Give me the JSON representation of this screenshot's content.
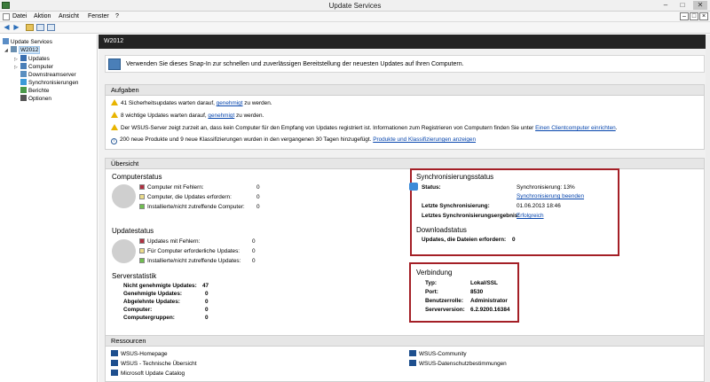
{
  "window": {
    "title": "Update Services"
  },
  "menu": {
    "items": [
      "Datei",
      "Aktion",
      "Ansicht",
      "Fenster",
      "?"
    ]
  },
  "tree": {
    "root": "Update Services",
    "server": "W2012",
    "items": [
      "Updates",
      "Computer",
      "Downstreamserver",
      "Synchronisierungen",
      "Berichte",
      "Optionen"
    ]
  },
  "main": {
    "header": "W2012",
    "intro": "Verwenden Sie dieses Snap-In zur schnellen und zuverlässigen Bereitstellung der neuesten Updates auf Ihren Computern."
  },
  "tasks": {
    "title": "Aufgaben",
    "line1": {
      "pre": "41 Sicherheitsupdates warten darauf, ",
      "link": "genehmigt",
      "post": " zu werden."
    },
    "line2": {
      "pre": "8 wichtige Updates warten darauf, ",
      "link": "genehmigt",
      "post": " zu werden."
    },
    "line3": {
      "pre": "Der WSUS-Server zeigt zurzeit an, dass kein Computer für den Empfang von Updates registriert ist. Informationen zum Registrieren von Computern finden Sie unter ",
      "link": "Einen Clientcomputer einrichten",
      "post": "."
    },
    "line4": {
      "pre": "200 neue Produkte und 9 neue Klassifizierungen wurden in den vergangenen 30 Tagen hinzugefügt. ",
      "link": "Produkte und Klassifizierungen anzeigen"
    }
  },
  "overview": {
    "title": "Übersicht",
    "computer_status": {
      "title": "Computerstatus",
      "rows": [
        {
          "label": "Computer mit Fehlern:",
          "value": "0",
          "color": "#b03040"
        },
        {
          "label": "Computer, die Updates erfordern:",
          "value": "0",
          "color": "#ecdc8a"
        },
        {
          "label": "Installierte/nicht zutreffende Computer:",
          "value": "0",
          "color": "#6fbf4f"
        }
      ]
    },
    "update_status": {
      "title": "Updatestatus",
      "rows": [
        {
          "label": "Updates mit Fehlern:",
          "value": "0",
          "color": "#b03040"
        },
        {
          "label": "Für Computer erforderliche Updates:",
          "value": "0",
          "color": "#ecdc8a"
        },
        {
          "label": "Installierte/nicht zutreffende Updates:",
          "value": "0",
          "color": "#6fbf4f"
        }
      ]
    },
    "server_stats": {
      "title": "Serverstatistik",
      "rows": [
        {
          "label": "Nicht genehmigte Updates:",
          "value": "47"
        },
        {
          "label": "Genehmigte Updates:",
          "value": "0"
        },
        {
          "label": "Abgelehnte Updates:",
          "value": "0"
        },
        {
          "label": "Computer:",
          "value": "0"
        },
        {
          "label": "Computergruppen:",
          "value": "0"
        }
      ]
    },
    "sync": {
      "title": "Synchronisierungsstatus",
      "status_label": "Status:",
      "status_value": "Synchronisierung: 13%",
      "status_link": "Synchronisierung beenden",
      "last_sync_label": "Letzte Synchronisierung:",
      "last_sync_value": "01.06.2013 18:46",
      "last_result_label": "Letztes Synchronisierungsergebnis:",
      "last_result_value": "Erfolgreich"
    },
    "download": {
      "title": "Downloadstatus",
      "label": "Updates, die Dateien erfordern:",
      "value": "0"
    },
    "connection": {
      "title": "Verbindung",
      "rows": [
        {
          "label": "Typ:",
          "value": "Lokal/SSL"
        },
        {
          "label": "Port:",
          "value": "8530"
        },
        {
          "label": "Benutzerrolle:",
          "value": "Administrator"
        },
        {
          "label": "Serverversion:",
          "value": "6.2.9200.16384"
        }
      ]
    }
  },
  "resources": {
    "title": "Ressourcen",
    "left": [
      "WSUS-Homepage",
      "WSUS - Technische Übersicht",
      "Microsoft Update Catalog"
    ],
    "right": [
      "WSUS-Community",
      "WSUS-Datenschutzbestimmungen"
    ]
  },
  "colors": {
    "highlight": "#a41f26",
    "link": "#0645ad",
    "header": "#232323"
  }
}
